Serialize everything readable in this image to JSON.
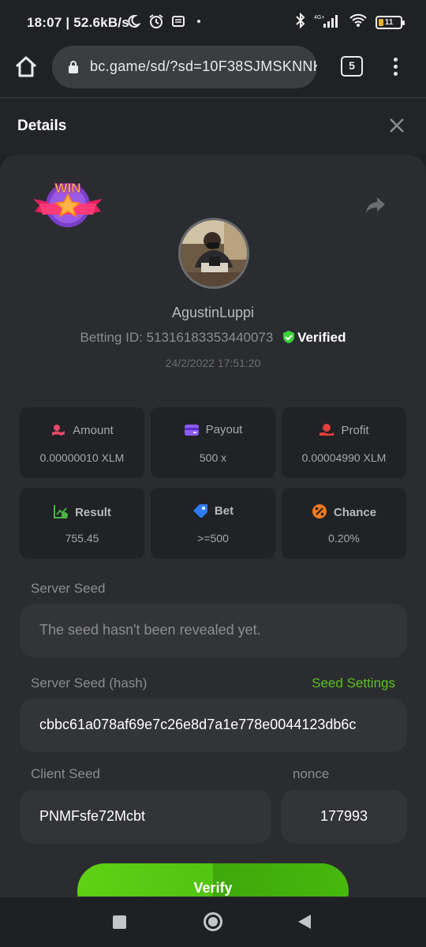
{
  "status_bar": {
    "time": "18:07 | 52.6kB/s",
    "battery": "11",
    "network": "4G+"
  },
  "browser": {
    "url": "bc.game/sd/?sd=10F38SJMSKNNK",
    "tab_count": "5"
  },
  "dialog": {
    "title": "Details"
  },
  "player": {
    "badge": "WIN",
    "username": "AgustinLuppi",
    "betting_id_label": "Betting ID:",
    "betting_id": "51316183353440073",
    "verified_label": "Verified",
    "timestamp": "24/2/2022 17:51:20"
  },
  "stats": [
    {
      "label": "Amount",
      "value": "0.00000010 XLM",
      "icon": "amount-icon",
      "color": "#e8476a"
    },
    {
      "label": "Payout",
      "value": "500 x",
      "icon": "payout-icon",
      "color": "#8b5cf6"
    },
    {
      "label": "Profit",
      "value": "0.00004990 XLM",
      "icon": "profit-icon",
      "color": "#e83e3e"
    },
    {
      "label": "Result",
      "value": "755.45",
      "icon": "result-icon",
      "color": "#4bb543"
    },
    {
      "label": "Bet",
      "value": ">=500",
      "icon": "bet-icon",
      "color": "#2f7bf5"
    },
    {
      "label": "Chance",
      "value": "0.20%",
      "icon": "chance-icon",
      "color": "#f07a21"
    }
  ],
  "seeds": {
    "server_seed_label": "Server Seed",
    "server_seed_placeholder": "The seed hasn't been revealed yet.",
    "server_seed_hash_label": "Server Seed (hash)",
    "seed_settings_link": "Seed Settings",
    "server_seed_hash": "cbbc61a078af69e7c26e8d7a1e778e0044123db6c",
    "client_seed_label": "Client Seed",
    "client_seed": "PNMFsfe72Mcbt",
    "nonce_label": "nonce",
    "nonce": "177993"
  },
  "actions": {
    "verify_label": "Verify"
  },
  "colors": {
    "accent_green": "#5cc11e",
    "card_bg": "#2b2c30",
    "verified_green": "#3ecf3e"
  }
}
